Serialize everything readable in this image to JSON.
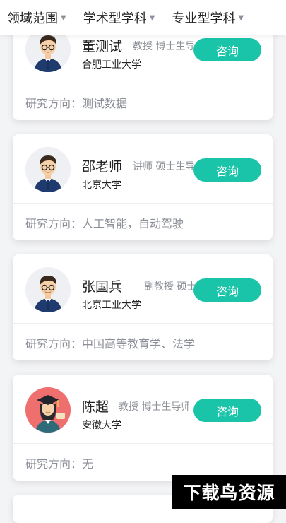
{
  "filters": [
    {
      "label": "领域范围"
    },
    {
      "label": "学术型学科"
    },
    {
      "label": "专业型学科"
    }
  ],
  "research_label": "研究方向：",
  "consult_label": "咨询",
  "cards": [
    {
      "name": "董测试",
      "title": "教授 博士生导师",
      "school": "合肥工业大学",
      "research": "测试数据",
      "avatar": "male-teacher-avatar"
    },
    {
      "name": "邵老师",
      "title": "讲师 硕士生导师",
      "school": "北京大学",
      "research": "人工智能，自动驾驶",
      "avatar": "male-teacher-avatar"
    },
    {
      "name": "张国兵",
      "title": "副教授 硕士生导师",
      "school": "北京工业大学",
      "research": "中国高等教育学、法学",
      "avatar": "male-teacher-avatar"
    },
    {
      "name": "陈超",
      "title": "教授 博士生导师",
      "school": "安徽大学",
      "research": "无",
      "avatar": "female-graduate-avatar"
    }
  ],
  "watermark": "下载鸟资源",
  "colors": {
    "accent": "#19c4a9",
    "muted": "#8b8f97"
  }
}
